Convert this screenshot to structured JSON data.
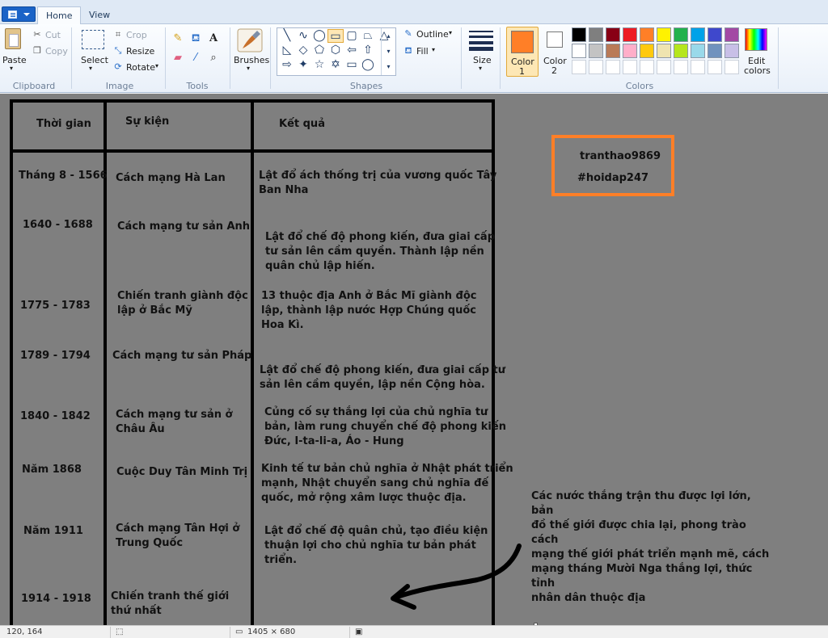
{
  "tabs": {
    "home": "Home",
    "view": "View"
  },
  "clipboard": {
    "paste": "Paste",
    "cut": "Cut",
    "copy": "Copy",
    "group": "Clipboard"
  },
  "image": {
    "select": "Select",
    "crop": "Crop",
    "resize": "Resize",
    "rotate": "Rotate",
    "group": "Image"
  },
  "tools": {
    "group": "Tools"
  },
  "brushes": {
    "label": "Brushes"
  },
  "shapes": {
    "outline": "Outline",
    "fill": "Fill",
    "group": "Shapes"
  },
  "size": {
    "label": "Size"
  },
  "colors": {
    "color1_line1": "Color",
    "color1_line2": "1",
    "color2_line1": "Color",
    "color2_line2": "2",
    "edit_line1": "Edit",
    "edit_line2": "colors",
    "group": "Colors",
    "color1": "#ff7f27",
    "color2": "#ffffff",
    "palette": [
      "#000000",
      "#7f7f7f",
      "#880015",
      "#ed1c24",
      "#ff7f27",
      "#fff200",
      "#22b14c",
      "#00a2e8",
      "#3f48cc",
      "#a349a4",
      "#ffffff",
      "#c3c3c3",
      "#b97a57",
      "#ffaec9",
      "#ffc90e",
      "#efe4b0",
      "#b5e61d",
      "#99d9ea",
      "#7092be",
      "#c8bfe7"
    ]
  },
  "table": {
    "headers": {
      "time": "Thời gian",
      "event": "Sự kiện",
      "result": "Kết quả"
    },
    "rows": [
      {
        "time": "Tháng 8 - 1566",
        "event": "Cách mạng Hà Lan",
        "result": [
          "Lật đổ ách thống trị của vương quốc Tây",
          "Ban Nha"
        ]
      },
      {
        "time": "1640 - 1688",
        "event": "Cách mạng tư sản Anh",
        "result": [
          "Lật đổ chế độ phong kiến, đưa giai cấp",
          "tư sản lên cầm quyền. Thành lập nền",
          "quân chủ lập hiến."
        ]
      },
      {
        "time": "1775 - 1783",
        "event": [
          "Chiến tranh giành độc",
          "lập ở Bắc Mỹ"
        ],
        "result": [
          "13 thuộc địa Anh ở Bắc Mĩ giành độc",
          "lập, thành lập nước Hợp Chúng quốc",
          "Hoa Kì."
        ]
      },
      {
        "time": "1789 - 1794",
        "event": "Cách mạng tư sản Pháp",
        "result": [
          "Lật đổ chế độ phong kiến, đưa giai cấp tư",
          "sản lên cầm quyền, lập nền Cộng hòa."
        ]
      },
      {
        "time": "1840 - 1842",
        "event": [
          "Cách mạng tư sản ở",
          "Châu Âu"
        ],
        "result": [
          "Củng cố sự thắng lợi của chủ nghĩa tư",
          "bản, làm rung chuyển chế độ phong kiến",
          "Đức, I-ta-li-a, Áo - Hung"
        ]
      },
      {
        "time": "Năm 1868",
        "event": "Cuộc Duy Tân Minh Trị",
        "result": [
          "Kinh tế tư bản chủ nghĩa ở Nhật phát triển",
          "mạnh, Nhật chuyển sang chủ nghĩa đế",
          "quốc, mở rộng xâm lược thuộc địa."
        ]
      },
      {
        "time": "Năm 1911",
        "event": [
          "Cách mạng Tân Hợi ở",
          "Trung Quốc"
        ],
        "result": [
          "Lật đổ chế độ quân chủ, tạo điều kiện",
          "thuận lợi cho chủ nghĩa tư bản phát",
          "triển."
        ]
      },
      {
        "time": "1914 - 1918",
        "event": [
          "Chiến tranh thế giới",
          "thứ nhất"
        ],
        "result": []
      }
    ]
  },
  "signature": {
    "user": "tranthao9869",
    "tag": "#hoidap247"
  },
  "note": [
    "Các nước thắng trận thu được lợi lớn, bản",
    "đồ thế giới được chia lại, phong trào cách",
    "mạng thế giới phát triển mạnh mẽ, cách",
    "mạng tháng Mười Nga thắng lợi, thức tỉnh",
    "nhân dân thuộc địa"
  ],
  "status": {
    "cursor": "120, 164",
    "size": "1405 × 680"
  }
}
